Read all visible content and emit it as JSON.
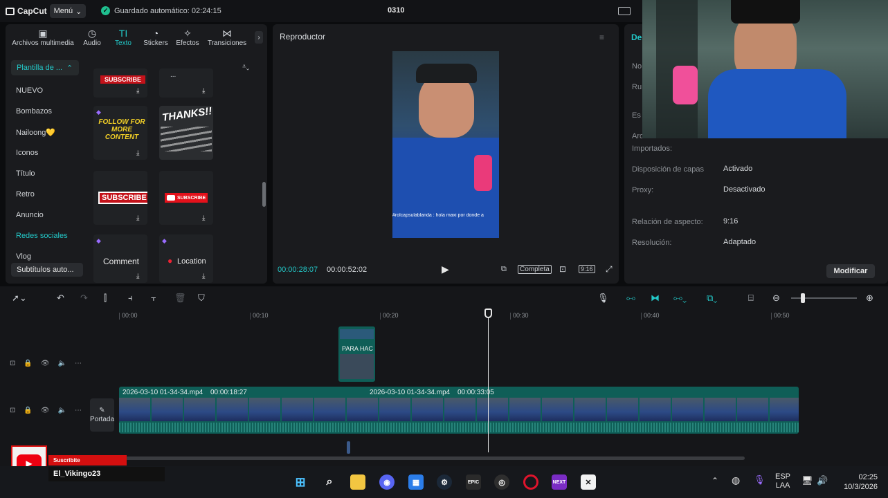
{
  "app": {
    "name": "CapCut",
    "menu_label": "Menú",
    "autosave": "Guardado automático: 02:24:15",
    "project_title": "0310"
  },
  "toolbar_tabs": [
    {
      "label": "Archivos multimedia",
      "icon": "media-icon"
    },
    {
      "label": "Audio",
      "icon": "audio-icon"
    },
    {
      "label": "Texto",
      "icon": "text-icon",
      "active": true
    },
    {
      "label": "Stickers",
      "icon": "stickers-icon"
    },
    {
      "label": "Efectos",
      "icon": "effects-icon"
    },
    {
      "label": "Transiciones",
      "icon": "transitions-icon"
    }
  ],
  "sidebar": {
    "category": "Plantilla de ...",
    "items": [
      "NUEVO",
      "Bombazos",
      "Nailoong💛",
      "Iconos",
      "Título",
      "Retro",
      "Anuncio",
      "Redes sociales",
      "Vlog"
    ],
    "highlighted": "Redes sociales",
    "subtitles_button": "Subtítulos auto..."
  },
  "templates": [
    {
      "text": "SUBSCRIBE"
    },
    {
      "text": "..."
    },
    {
      "text": "FOLLOW FOR MORE CONTENT"
    },
    {
      "text": "THANKS!!"
    },
    {
      "text": "SUBSCRIBE"
    },
    {
      "text": "SUBSCRIBE"
    },
    {
      "text": "Comment"
    },
    {
      "text": "Location"
    }
  ],
  "player": {
    "title": "Reproductor",
    "time_current": "00:00:28:07",
    "time_total": "00:00:52:02",
    "full_label": "Completa",
    "ratio_label": "9:16",
    "caption": "#rolcapsulablanda : hola maxi por donde a"
  },
  "details": {
    "header": "De",
    "rows": [
      {
        "label": "No",
        "value": ""
      },
      {
        "label": "Ru",
        "value": ""
      },
      {
        "label": "Es",
        "value": ""
      },
      {
        "label": "Arc",
        "value": ""
      },
      {
        "label": "Importados:",
        "value": ""
      },
      {
        "label": "Disposición de capas",
        "value": "Activado"
      },
      {
        "label": "Proxy:",
        "value": "Desactivado"
      },
      {
        "label": "Relación de aspecto:",
        "value": "9:16"
      },
      {
        "label": "Resolución:",
        "value": "Adaptado"
      }
    ],
    "modify_button": "Modificar"
  },
  "timeline": {
    "ruler": [
      "00:00",
      "00:10",
      "00:20",
      "00:30",
      "00:40",
      "00:50"
    ],
    "cover_label": "Portada",
    "clips": [
      {
        "name": "2026-03-10 01-34-34.mp4",
        "duration": "00:00:18:27"
      },
      {
        "name": "2026-03-10 01-34-34.mp4",
        "duration": "00:00:33:05"
      }
    ],
    "overlay_clip_text": "PARA HAC"
  },
  "subscribe_overlay": {
    "label": "Suscribite",
    "channel": "El_Vikingo23"
  },
  "taskbar": {
    "lang": "ESP",
    "region": "LAA",
    "time": "02:25",
    "date": "10/3/2026",
    "apps": [
      "windows",
      "search",
      "explorer",
      "discord",
      "store",
      "steam",
      "epic",
      "obs",
      "opera",
      "next",
      "capcut"
    ]
  },
  "colors": {
    "accent": "#23c8c8",
    "clip": "#0f5e57",
    "panel": "#1a1b1e"
  }
}
